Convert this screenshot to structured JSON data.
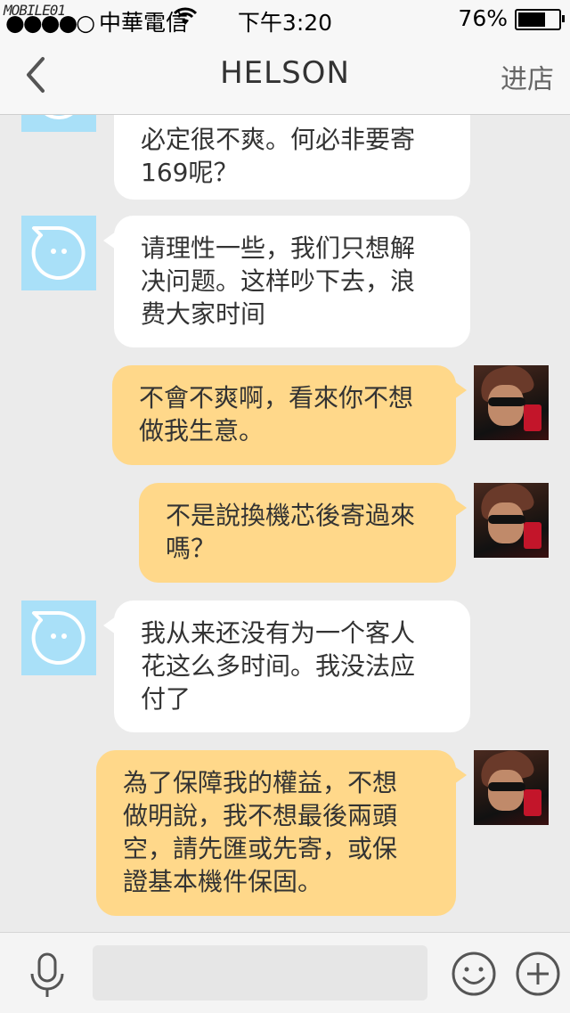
{
  "status_bar": {
    "watermark": "MOBILE01",
    "carrier": "中華電信",
    "time": "下午3:20",
    "battery": "76%",
    "battery_level": 0.76
  },
  "nav": {
    "title": "HELSON",
    "right_action": "进店",
    "back_icon": "chevron-left-icon"
  },
  "messages": [
    {
      "side": "in",
      "lines": [
        "必定很不爽。何必非要寄",
        "169呢？"
      ]
    },
    {
      "side": "in",
      "lines": [
        "请理性一些，我们只想解",
        "决问题。这样吵下去，浪",
        "费大家时间"
      ]
    },
    {
      "side": "out",
      "lines": [
        "不會不爽啊，看來你不想",
        "做我生意。"
      ]
    },
    {
      "side": "out",
      "lines": [
        "不是說換機芯後寄過來",
        "嗎？"
      ]
    },
    {
      "side": "in",
      "lines": [
        "我从来还没有为一个客人",
        "花这么多时间。我没法应",
        "付了"
      ]
    },
    {
      "side": "out",
      "lines": [
        "為了保障我的權益，不想",
        "做明說，我不想最後兩頭",
        "空，請先匯或先寄，或保",
        "證基本機件保固。"
      ]
    }
  ],
  "input_bar": {
    "placeholder": "",
    "icons": [
      "microphone-icon",
      "emoji-icon",
      "plus-icon"
    ]
  },
  "colors": {
    "incoming_bubble": "#ffffff",
    "outgoing_bubble": "#ffd88a",
    "bot_avatar": "#a9e0f8",
    "background": "#ebebeb"
  }
}
